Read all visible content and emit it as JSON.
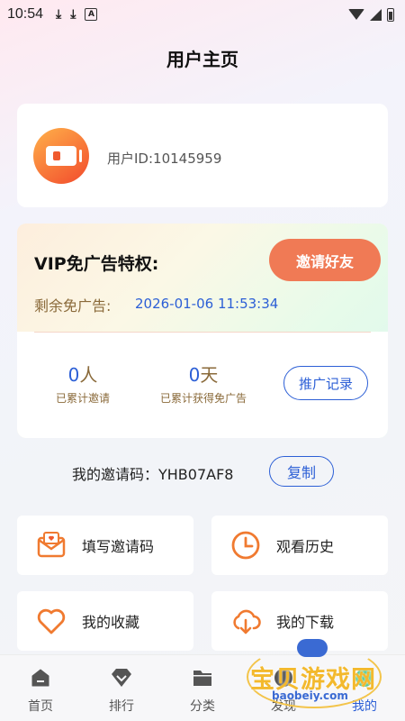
{
  "status_bar": {
    "time": "10:54",
    "dl1": "⤓",
    "dl2": "⤓",
    "a_icon": "A"
  },
  "page_title": "用户主页",
  "user": {
    "id_text": "用户ID:10145959"
  },
  "vip": {
    "title": "VIP免广告特权:",
    "invite_button": "邀请好友",
    "remaining_label": "剩余免广告:",
    "remaining_date": "2026-01-06 11:53:34",
    "stats": [
      {
        "value": "0",
        "unit": "人",
        "label": "已累计邀请"
      },
      {
        "value": "0",
        "unit": "天",
        "label": "已累计获得免广告"
      }
    ],
    "promo_button": "推广记录"
  },
  "invite_code": {
    "label": "我的邀请码：YHB07AF8",
    "copy_button": "复制"
  },
  "tiles": [
    {
      "label": "填写邀请码",
      "icon": "envelope-heart-icon"
    },
    {
      "label": "观看历史",
      "icon": "clock-icon"
    },
    {
      "label": "我的收藏",
      "icon": "heart-icon"
    },
    {
      "label": "我的下载",
      "icon": "cloud-download-icon"
    }
  ],
  "tabbar": [
    {
      "label": "首页",
      "icon": "home-icon"
    },
    {
      "label": "排行",
      "icon": "diamond-icon"
    },
    {
      "label": "分类",
      "icon": "folder-icon"
    },
    {
      "label": "发现",
      "icon": "compass-icon"
    },
    {
      "label": "我的",
      "icon": "user-icon"
    }
  ],
  "watermark": {
    "text": "宝贝游戏网",
    "url": "baobeiy.com"
  },
  "colors": {
    "accent": "#2c5fd6",
    "orange": "#f07a55",
    "brown": "#8a6a3a"
  }
}
